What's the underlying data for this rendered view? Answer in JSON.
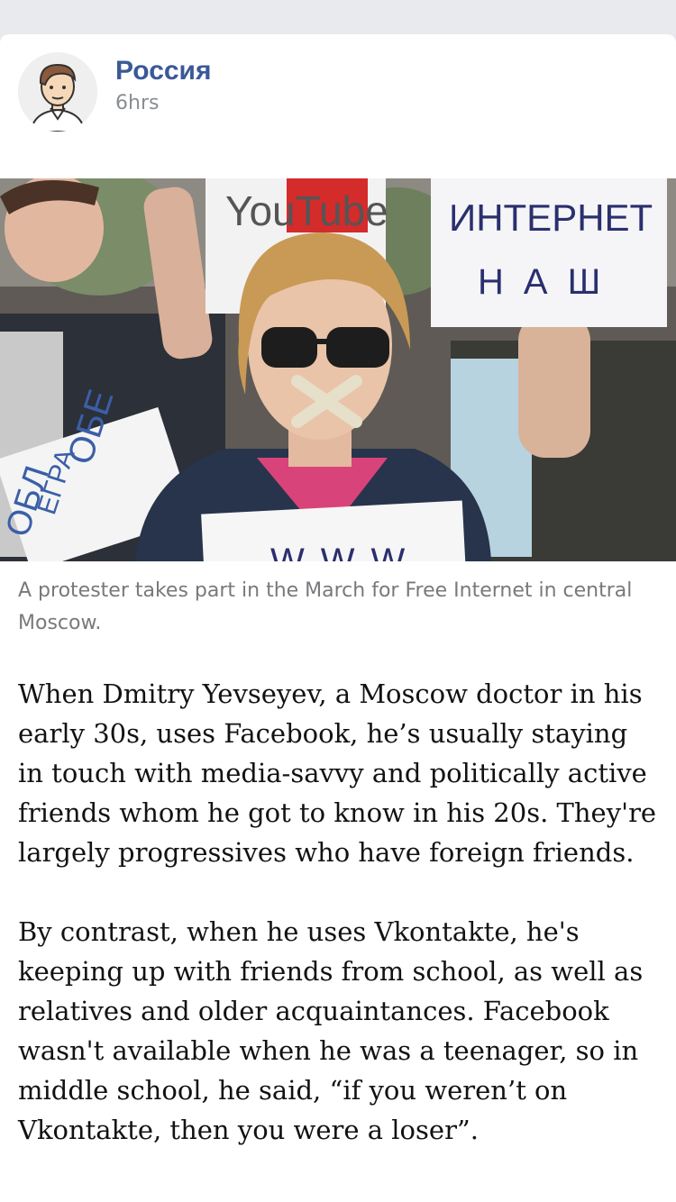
{
  "post": {
    "author": "Россия",
    "time": "6hrs"
  },
  "photo": {
    "sign_youtube": "YouTube",
    "sign_internet_line1": "ИНТЕРНЕТ",
    "sign_internet_line2": "НАШ",
    "sign_bottom": "WWW",
    "sign_left_1": "ОБЕ",
    "sign_left_2": "ЕГРА",
    "sign_left_3": "ОБЛ"
  },
  "caption": "A protester takes part in the March for Free Internet in central Moscow.",
  "article": {
    "paragraphs": [
      "When Dmitry Yevseyev, a Moscow doctor in his early 30s, uses Facebook, he’s usually staying in touch with media-savvy and politically active friends whom he got to know in his 20s. They're largely progressives who have foreign friends.",
      "By contrast, when he uses Vkontakte, he's keeping up with friends from school, as well as relatives and older acquaintances. Facebook wasn't available when he was a teenager, so in middle school, he said, “if you weren’t on Vkontakte, then you were a loser”."
    ]
  }
}
